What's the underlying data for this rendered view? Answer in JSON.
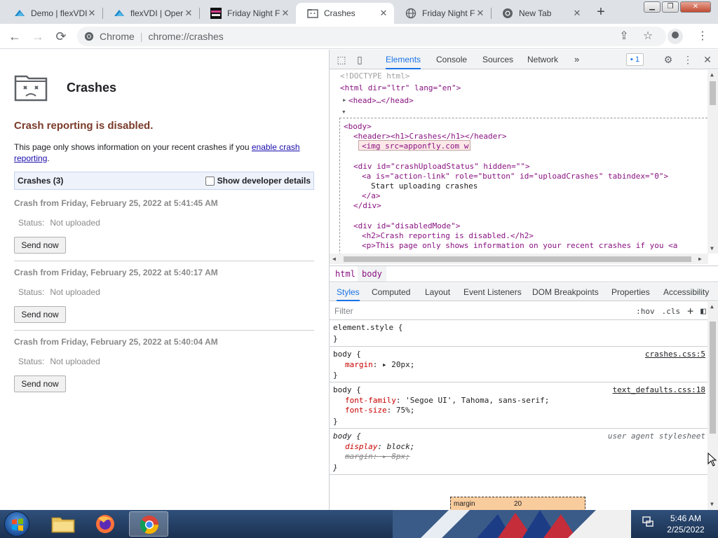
{
  "browser": {
    "tabs": [
      {
        "title": "Demo | flexVDI",
        "favicon": "flexvdi-icon"
      },
      {
        "title": "flexVDI | Oper",
        "favicon": "flexvdi-icon"
      },
      {
        "title": "Friday Night F",
        "favicon": "fnf-icon"
      },
      {
        "title": "Crashes",
        "favicon": "sad-folder-icon",
        "active": true
      },
      {
        "title": "Friday Night F",
        "favicon": "globe-icon"
      },
      {
        "title": "New Tab",
        "favicon": "chrome-icon"
      }
    ],
    "omnibox": {
      "chip": "Chrome",
      "url": "chrome://crashes"
    }
  },
  "page": {
    "title": "Crashes",
    "disabled_heading": "Crash reporting is disabled.",
    "info_text": "This page only shows information on your recent crashes if you",
    "info_link": "enable crash reporting",
    "info_end": ".",
    "list_header": "Crashes (3)",
    "dev_details_label": "Show developer details",
    "crashes": [
      {
        "title": "Crash from Friday, February 25, 2022 at 5:41:45 AM",
        "status_label": "Status:",
        "status_value": "Not uploaded",
        "button": "Send now"
      },
      {
        "title": "Crash from Friday, February 25, 2022 at 5:40:17 AM",
        "status_label": "Status:",
        "status_value": "Not uploaded",
        "button": "Send now"
      },
      {
        "title": "Crash from Friday, February 25, 2022 at 5:40:04 AM",
        "status_label": "Status:",
        "status_value": "Not uploaded",
        "button": "Send now"
      }
    ]
  },
  "devtools": {
    "tabs": [
      "Elements",
      "Console",
      "Sources",
      "Network"
    ],
    "more": "»",
    "issues_count": "1",
    "dom": {
      "doctype": "<!DOCTYPE html>",
      "html_open": "<html dir=\"ltr\" lang=\"en\">",
      "head": "<head>…</head>",
      "body_open": "<body>",
      "header": "<header><h1>Crashes</h1></header>",
      "img": "<img src=apponfly.com w",
      "div1_open": "<div id=\"crashUploadStatus\" hidden=\"\">",
      "a_open": "<a is=\"action-link\" role=\"button\" id=\"uploadCrashes\" tabindex=\"0\">",
      "a_text": "Start uploading crashes",
      "a_close": "</a>",
      "div_close": "</div>",
      "div2_open": "<div id=\"disabledMode\">",
      "h2": "<h2>Crash reporting is disabled.</h2>",
      "p": "<p>This page only shows information on your recent crashes if you <a"
    },
    "breadcrumb": [
      "html",
      "body"
    ],
    "subtabs": [
      "Styles",
      "Computed",
      "Layout",
      "Event Listeners",
      "DOM Breakpoints",
      "Properties",
      "Accessibility"
    ],
    "filter_placeholder": "Filter",
    "filter_hov": ":hov",
    "filter_cls": ".cls",
    "filter_plus": "+",
    "rules": [
      {
        "selector": "element.style {",
        "close": "}"
      },
      {
        "selector": "body {",
        "source": "crashes.css:5",
        "props": [
          {
            "name": "margin",
            "value": "20px;"
          }
        ],
        "close": "}"
      },
      {
        "selector": "body {",
        "source": "text_defaults.css:18",
        "props": [
          {
            "name": "font-family",
            "value": "'Segoe UI', Tahoma, sans-serif;"
          },
          {
            "name": "font-size",
            "value": "75%;"
          }
        ],
        "close": "}"
      },
      {
        "selector": "body {",
        "source": "user agent stylesheet",
        "props": [
          {
            "name": "display",
            "value": "block;"
          },
          {
            "name": "margin",
            "value": "8px;"
          }
        ],
        "close": "}"
      }
    ],
    "boxmodel": {
      "label": "margin",
      "value": "20"
    }
  },
  "taskbar": {
    "time": "5:46 AM",
    "date": "2/25/2022"
  },
  "colors": {
    "accent": "#1a73e8",
    "heading_red": "#7a3b2a",
    "link": "#1a0dab"
  }
}
